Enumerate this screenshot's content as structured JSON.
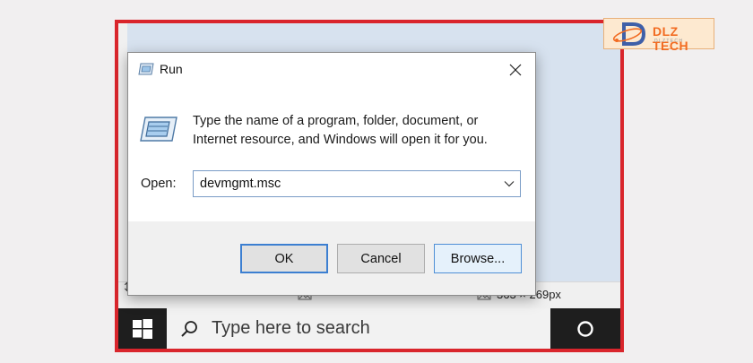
{
  "dialog": {
    "title": "Run",
    "description": "Type the name of a program, folder, document, or Internet resource, and Windows will open it for you.",
    "open_label": "Open:",
    "open_value": "devmgmt.msc",
    "ok_label": "OK",
    "cancel_label": "Cancel",
    "browse_label": "Browse..."
  },
  "statusbar": {
    "size_text": "363 × 269px"
  },
  "taskbar": {
    "search_placeholder": "Type here to search"
  },
  "logo": {
    "text": "DLZ TECH",
    "subtext": "D L Z   T E C H"
  },
  "colors": {
    "frame_border": "#d9252c",
    "taskbar": "#1e1e1e",
    "accent": "#3c7fd1",
    "logo_orange": "#f26b21"
  },
  "icons": [
    "run-icon",
    "close-icon",
    "chevron-down-icon",
    "windows-logo-icon",
    "search-icon",
    "cortana-icon",
    "resize-icon",
    "picture-icon"
  ]
}
